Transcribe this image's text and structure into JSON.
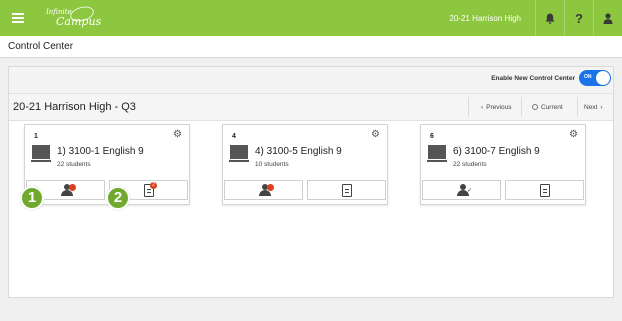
{
  "topbar": {
    "logo_line1": "Infinite",
    "logo_line2": "Campus",
    "school": "20-21 Harrison High",
    "help_label": "?"
  },
  "page_title": "Control Center",
  "control_center": {
    "toggle_label": "Enable New Control Center",
    "toggle_state": "ON"
  },
  "term": {
    "title": "20-21 Harrison High - Q3",
    "previous_label": "Previous",
    "current_label": "Current",
    "next_label": "Next"
  },
  "cards": [
    {
      "period": "1",
      "course": "1) 3100-1 English 9",
      "students": "22 students",
      "attendance_icon": "attendance-alert-icon",
      "roster_icon": "roster-badge-icon"
    },
    {
      "period": "4",
      "course": "4) 3100-5 English 9",
      "students": "10 students",
      "attendance_icon": "attendance-alert-icon",
      "roster_icon": "document-icon"
    },
    {
      "period": "6",
      "course": "6) 3100-7 English 9",
      "students": "22 students",
      "attendance_icon": "attendance-done-icon",
      "roster_icon": "document-icon"
    }
  ],
  "roster_badge": "2",
  "callouts": [
    "1",
    "2"
  ],
  "colors": {
    "topbar": "#8dc63f",
    "toggle_on": "#1a73e8",
    "alert": "#d9401e",
    "callout": "#71a92f"
  }
}
